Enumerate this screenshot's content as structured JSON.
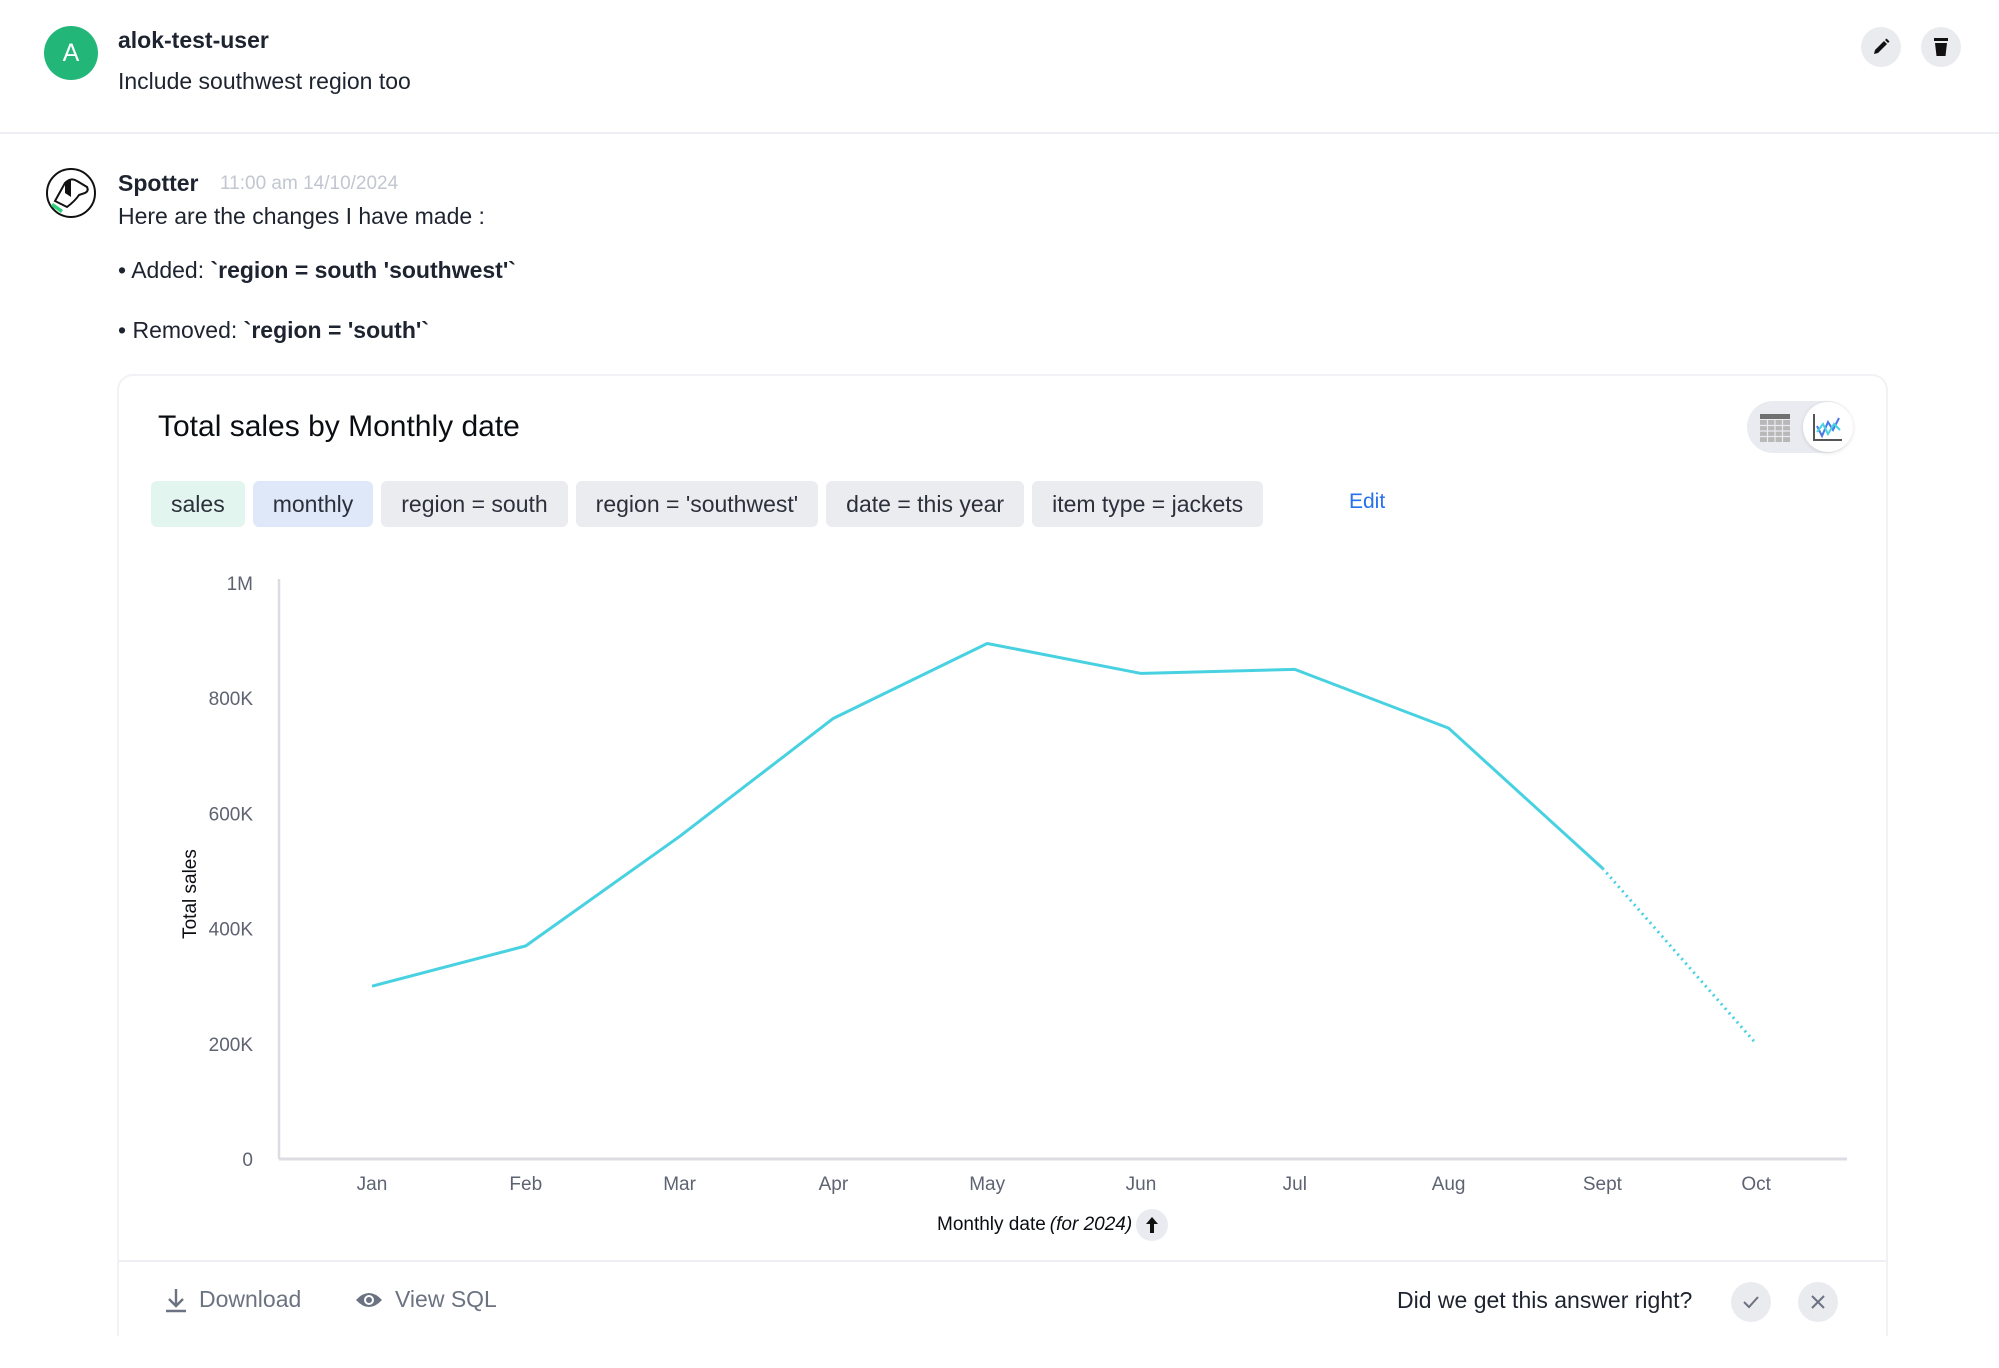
{
  "user_message": {
    "avatar_initial": "A",
    "avatar_color": "#22b779",
    "username": "alok-test-user",
    "text": "Include southwest region too",
    "actions": {
      "edit_icon": "pencil-icon",
      "delete_icon": "trash-icon"
    }
  },
  "assistant_message": {
    "name": "Spotter",
    "timestamp": "11:00 am 14/10/2024",
    "intro": "Here are the changes I have made :",
    "changes": [
      {
        "bullet": "•",
        "label": "Added: ",
        "code": "`region = south 'southwest'`"
      },
      {
        "bullet": "•",
        "label": "Removed: ",
        "code": "`region = 'south'`"
      }
    ]
  },
  "card": {
    "title": "Total sales by Monthly date",
    "view_toggle": {
      "options": [
        "table",
        "chart"
      ],
      "selected": "chart"
    },
    "chips": [
      {
        "label": "sales",
        "kind": "measure"
      },
      {
        "label": "monthly",
        "kind": "attribute"
      },
      {
        "label": "region = south",
        "kind": "filter"
      },
      {
        "label": "region = 'southwest'",
        "kind": "filter"
      },
      {
        "label": "date = this year",
        "kind": "filter"
      },
      {
        "label": "item type = jackets",
        "kind": "filter"
      }
    ],
    "edit_label": "Edit",
    "x_title_main": "Monthly date ",
    "x_title_italic": "(for 2024)",
    "footer": {
      "download_label": "Download",
      "view_sql_label": "View SQL",
      "feedback_question": "Did we get this answer right?"
    }
  },
  "chart_data": {
    "type": "line",
    "title": "Total sales by Monthly date",
    "xlabel": "Monthly date (for 2024)",
    "ylabel": "Total sales",
    "categories": [
      "Jan",
      "Feb",
      "Mar",
      "Apr",
      "May",
      "Jun",
      "Jul",
      "Aug",
      "Sept",
      "Oct"
    ],
    "series": [
      {
        "name": "Total sales",
        "color": "#48d1e0",
        "values": [
          300000,
          370000,
          560000,
          765000,
          895000,
          843000,
          850000,
          748000,
          505000,
          200000
        ],
        "incomplete_from_index": 8
      }
    ],
    "ylim": [
      0,
      1000000
    ],
    "yticks": [
      0,
      200000,
      400000,
      600000,
      800000,
      1000000
    ],
    "ytick_labels": [
      "0",
      "200K",
      "400K",
      "600K",
      "800K",
      "1M"
    ],
    "grid": false,
    "legend": "none"
  }
}
